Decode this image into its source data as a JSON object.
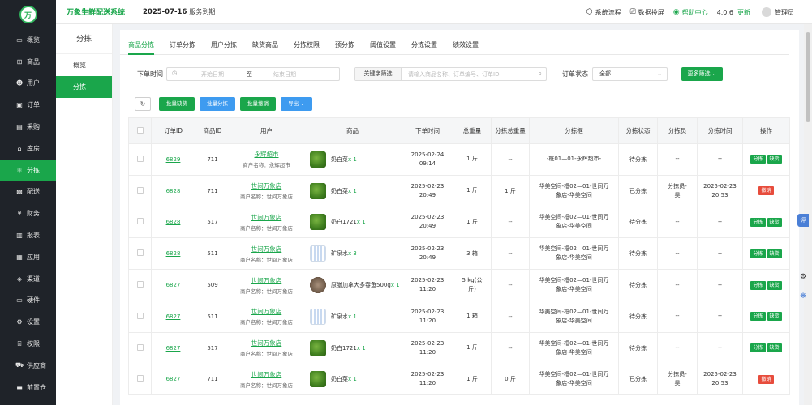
{
  "nav": {
    "logo_text": "万",
    "items": [
      {
        "icon": "▭",
        "label": "概览",
        "icon_name": "monitor-icon"
      },
      {
        "icon": "⊞",
        "label": "商品",
        "icon_name": "cart-icon"
      },
      {
        "icon": "☻",
        "label": "用户",
        "icon_name": "users-icon"
      },
      {
        "icon": "▣",
        "label": "订单",
        "icon_name": "order-icon"
      },
      {
        "icon": "▤",
        "label": "采购",
        "icon_name": "purchase-icon"
      },
      {
        "icon": "⌂",
        "label": "库房",
        "icon_name": "warehouse-icon"
      },
      {
        "icon": "⚛",
        "label": "分拣",
        "icon_name": "sorting-icon"
      },
      {
        "icon": "▩",
        "label": "配送",
        "icon_name": "delivery-icon"
      },
      {
        "icon": "¥",
        "label": "财务",
        "icon_name": "finance-icon"
      },
      {
        "icon": "▥",
        "label": "报表",
        "icon_name": "report-icon"
      },
      {
        "icon": "▦",
        "label": "应用",
        "icon_name": "apps-icon"
      },
      {
        "icon": "◈",
        "label": "渠道",
        "icon_name": "channel-icon"
      },
      {
        "icon": "▭",
        "label": "硬件",
        "icon_name": "hardware-icon"
      },
      {
        "icon": "⚙",
        "label": "设置",
        "icon_name": "settings-icon"
      },
      {
        "icon": "⌸",
        "label": "权限",
        "icon_name": "permission-icon"
      },
      {
        "icon": "⛟",
        "label": "供应商",
        "icon_name": "supplier-icon"
      },
      {
        "icon": "▬",
        "label": "前置仓",
        "icon_name": "front-warehouse-icon"
      }
    ]
  },
  "header": {
    "brand": "万象生鲜配送系统",
    "date": "2025-07-16",
    "expire": "服务到期",
    "links": {
      "flow": "系统流程",
      "screen": "数据投屏",
      "help": "帮助中心",
      "version": "4.0.6",
      "update": "更新",
      "user": "管理员"
    }
  },
  "subnav": {
    "title": "分拣",
    "items": [
      "概览",
      "分拣"
    ]
  },
  "tabs": [
    "商品分拣",
    "订单分拣",
    "用户分拣",
    "缺货商品",
    "分拣权限",
    "预分拣",
    "阈值设置",
    "分拣设置",
    "绩效设置"
  ],
  "filter": {
    "time_label": "下单时间",
    "start_ph": "开始日期",
    "to": "至",
    "end_ph": "结束日期",
    "kw_label": "关键字筛选",
    "kw_ph": "请输入商品名称、订单编号、订单ID",
    "status_label": "订单状态",
    "status_value": "全部",
    "more": "更多筛选 ⌄"
  },
  "actions": {
    "refresh": "↻",
    "batch_short": "批量缺货",
    "batch_sort": "批量分拣",
    "batch_cancel": "批量撤销",
    "export": "导出 ⌄"
  },
  "colors": {
    "green": "#1aa64b",
    "blue": "#3e9bf0",
    "red": "#e74c3c",
    "orange": "#e67e22"
  },
  "table": {
    "headers": [
      "订单ID",
      "商品ID",
      "用户",
      "商品",
      "下单时间",
      "总重量",
      "分拣总重量",
      "分拣框",
      "分拣状态",
      "分拣员",
      "分拣时间",
      "操作"
    ],
    "rows": [
      {
        "order_id": "6829",
        "product_id": "711",
        "user": "永辉超市",
        "merchant": "商户名称：永辉超市",
        "product": "奶白菜",
        "qty": "x 1",
        "thumb": "veg",
        "time1": "2025-02-24",
        "time2": "09:14",
        "weight": "1 斤",
        "sorted_weight": "--",
        "frame1": "-框01—01-永辉超市-",
        "frame2": "",
        "status": "待分拣",
        "status_type": "wait",
        "sorter1": "--",
        "sorter2": "",
        "sort_time1": "--",
        "sort_time2": "",
        "ops": [
          "分拣",
          "缺货"
        ]
      },
      {
        "order_id": "6828",
        "product_id": "711",
        "user": "世间万象店",
        "merchant": "商户名称：世间万象店",
        "product": "奶白菜",
        "qty": "x 1",
        "thumb": "veg",
        "time1": "2025-02-23",
        "time2": "20:49",
        "weight": "1 斤",
        "sorted_weight": "1 斤",
        "frame1": "华美空间-框02—01-世间万",
        "frame2": "象店-华美空间",
        "status": "已分拣",
        "status_type": "done",
        "sorter1": "分拣员-",
        "sorter2": "昊",
        "sort_time1": "2025-02-23",
        "sort_time2": "20:53",
        "ops": [
          "撤销"
        ]
      },
      {
        "order_id": "6828",
        "product_id": "517",
        "user": "世间万象店",
        "merchant": "商户名称：世间万象店",
        "product": "奶白1721",
        "qty": "x 1",
        "thumb": "veg",
        "time1": "2025-02-23",
        "time2": "20:49",
        "weight": "1 斤",
        "sorted_weight": "--",
        "frame1": "华美空间-框02—01-世间万",
        "frame2": "象店-华美空间",
        "status": "待分拣",
        "status_type": "wait",
        "sorter1": "--",
        "sorter2": "",
        "sort_time1": "--",
        "sort_time2": "",
        "ops": [
          "分拣",
          "缺货"
        ]
      },
      {
        "order_id": "6828",
        "product_id": "511",
        "user": "世间万象店",
        "merchant": "商户名称：世间万象店",
        "product": "矿泉水",
        "qty": "x 3",
        "thumb": "water",
        "time1": "2025-02-23",
        "time2": "20:49",
        "weight": "3 箱",
        "sorted_weight": "--",
        "frame1": "华美空间-框02—01-世间万",
        "frame2": "象店-华美空间",
        "status": "待分拣",
        "status_type": "wait",
        "sorter1": "--",
        "sorter2": "",
        "sort_time1": "--",
        "sort_time2": "",
        "ops": [
          "分拣",
          "缺货"
        ]
      },
      {
        "order_id": "6827",
        "product_id": "509",
        "user": "世间万象店",
        "merchant": "商户名称：世间万象店",
        "product": "原膳加拿大多春鱼500g",
        "qty": "x 1",
        "thumb": "fish",
        "time1": "2025-02-23",
        "time2": "11:20",
        "weight": "5 kg(公",
        "weight2": "斤)",
        "sorted_weight": "--",
        "frame1": "华美空间-框02—01-世间万",
        "frame2": "象店-华美空间",
        "status": "待分拣",
        "status_type": "wait",
        "sorter1": "--",
        "sorter2": "",
        "sort_time1": "--",
        "sort_time2": "",
        "ops": [
          "分拣",
          "缺货"
        ]
      },
      {
        "order_id": "6827",
        "product_id": "511",
        "user": "世间万象店",
        "merchant": "商户名称：世间万象店",
        "product": "矿泉水",
        "qty": "x 1",
        "thumb": "water",
        "time1": "2025-02-23",
        "time2": "11:20",
        "weight": "1 箱",
        "sorted_weight": "--",
        "frame1": "华美空间-框02—01-世间万",
        "frame2": "象店-华美空间",
        "status": "待分拣",
        "status_type": "wait",
        "sorter1": "--",
        "sorter2": "",
        "sort_time1": "--",
        "sort_time2": "",
        "ops": [
          "分拣",
          "缺货"
        ]
      },
      {
        "order_id": "6827",
        "product_id": "517",
        "user": "世间万象店",
        "merchant": "商户名称：世间万象店",
        "product": "奶白1721",
        "qty": "x 1",
        "thumb": "veg",
        "time1": "2025-02-23",
        "time2": "11:20",
        "weight": "1 斤",
        "sorted_weight": "--",
        "frame1": "华美空间-框02—01-世间万",
        "frame2": "象店-华美空间",
        "status": "待分拣",
        "status_type": "wait",
        "sorter1": "--",
        "sorter2": "",
        "sort_time1": "--",
        "sort_time2": "",
        "ops": [
          "分拣",
          "缺货"
        ]
      },
      {
        "order_id": "6827",
        "product_id": "711",
        "user": "世间万象店",
        "merchant": "商户名称：世间万象店",
        "product": "奶白菜",
        "qty": "x 1",
        "thumb": "veg",
        "time1": "2025-02-23",
        "time2": "11:20",
        "weight": "1 斤",
        "sorted_weight": "0 斤",
        "frame1": "华美空间-框02—01-世间万",
        "frame2": "象店-华美空间",
        "status": "已分拣",
        "status_type": "done",
        "sorter1": "分拣员-",
        "sorter2": "昊",
        "sort_time1": "2025-02-23",
        "sort_time2": "20:53",
        "ops": [
          "撤销"
        ]
      }
    ]
  },
  "float": {
    "b1": "评",
    "b2": "⚙",
    "b3": "❋"
  }
}
